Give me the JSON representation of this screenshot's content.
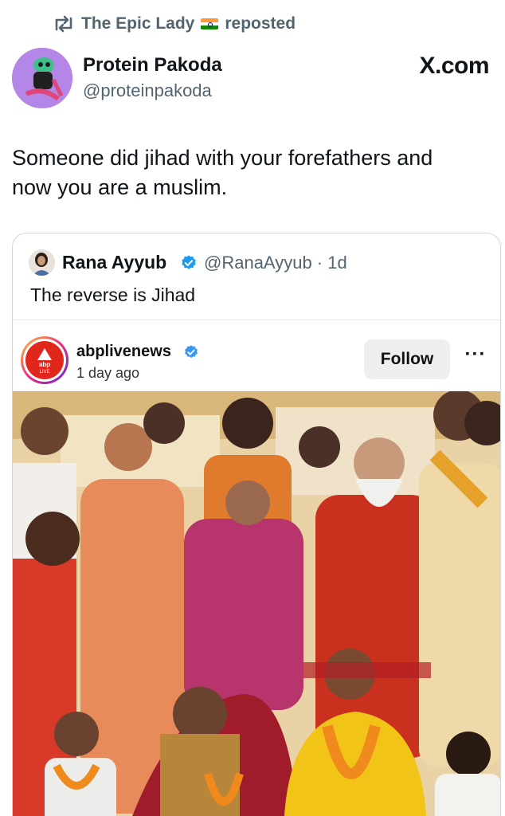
{
  "repost": {
    "reposter": "The Epic Lady",
    "suffix": "reposted"
  },
  "author": {
    "name": "Protein Pakoda",
    "handle": "@proteinpakoda"
  },
  "brand": "X.com",
  "tweet": {
    "text_line1": "Someone did jihad with your forefathers and",
    "text_line2": "now you are a muslim."
  },
  "quoted": {
    "name": "Rana Ayyub",
    "handle": "@RanaAyyub · 1d",
    "text": "The reverse is Jihad",
    "embed": {
      "account": "abplivenews",
      "time": "1 day ago",
      "follow_label": "Follow",
      "more_label": "···",
      "logo_text_top": "abp",
      "logo_text_bottom": "LIVE"
    }
  },
  "colors": {
    "text": "#0f1419",
    "secondary": "#536471",
    "verified": "#1d9bf0",
    "ig_verified": "#3897f0",
    "abp_red": "#e1261c"
  },
  "icons": [
    "repost-icon",
    "verified-badge-icon",
    "more-icon"
  ]
}
